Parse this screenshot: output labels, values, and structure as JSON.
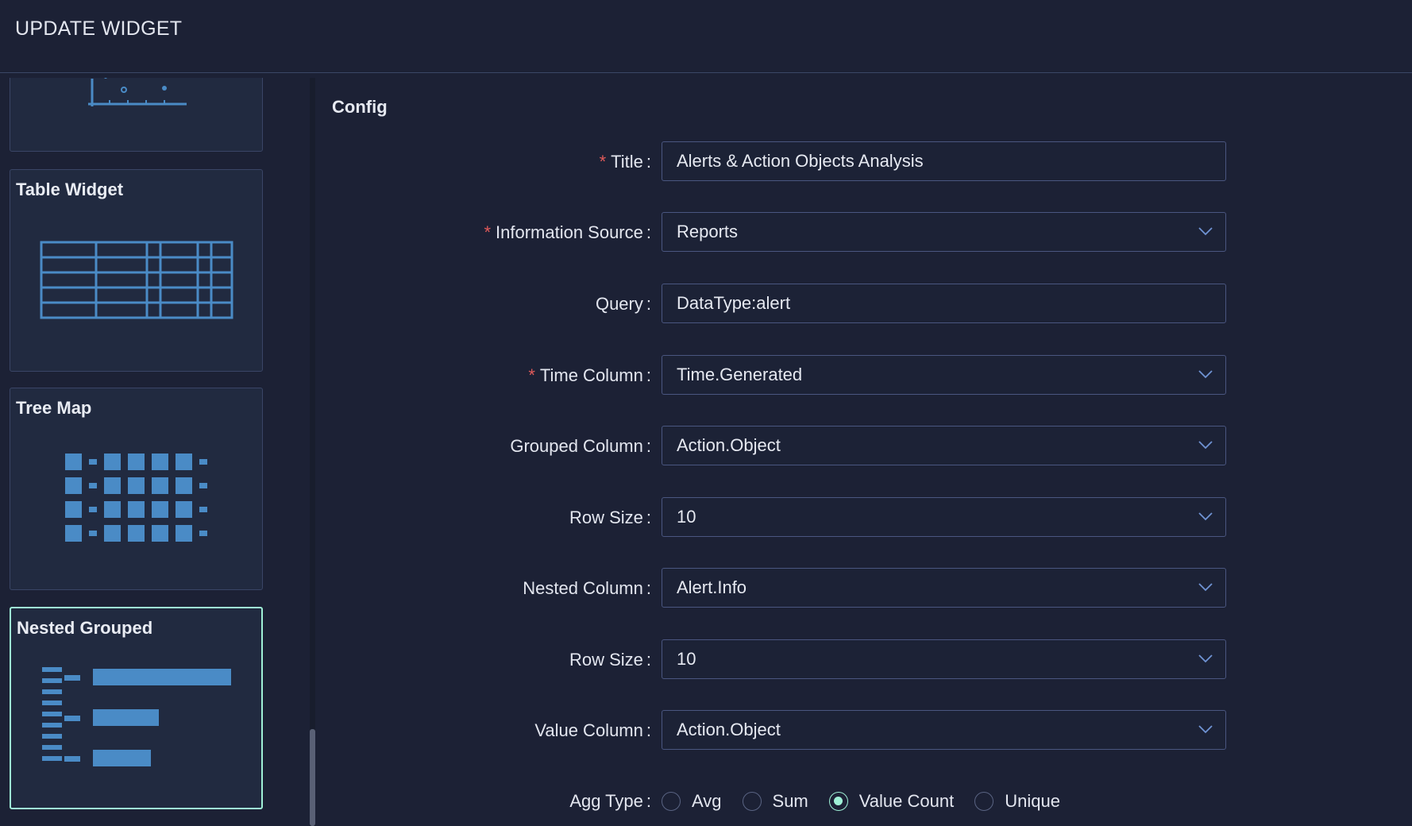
{
  "header": {
    "title": "UPDATE WIDGET"
  },
  "sidebar": {
    "cards": [
      {
        "title": "",
        "icon": "scatter-chart-icon"
      },
      {
        "title": "Table Widget",
        "icon": "table-grid-icon"
      },
      {
        "title": "Tree Map",
        "icon": "treemap-icon"
      },
      {
        "title": "Nested Grouped",
        "icon": "nested-bars-icon",
        "selected": true
      }
    ]
  },
  "config": {
    "title": "Config",
    "fields": {
      "title": {
        "label": "Title",
        "required": true,
        "value": "Alerts & Action Objects Analysis"
      },
      "info_source": {
        "label": "Information Source",
        "required": true,
        "value": "Reports"
      },
      "query": {
        "label": "Query",
        "required": false,
        "value": "DataType:alert"
      },
      "time_column": {
        "label": "Time Column",
        "required": true,
        "value": "Time.Generated"
      },
      "grouped_column": {
        "label": "Grouped Column",
        "required": false,
        "value": "Action.Object"
      },
      "row_size_1": {
        "label": "Row Size",
        "required": false,
        "value": "10"
      },
      "nested_column": {
        "label": "Nested Column",
        "required": false,
        "value": "Alert.Info"
      },
      "row_size_2": {
        "label": "Row Size",
        "required": false,
        "value": "10"
      },
      "value_column": {
        "label": "Value Column",
        "required": false,
        "value": "Action.Object"
      }
    },
    "agg_type": {
      "label": "Agg Type",
      "options": [
        "Avg",
        "Sum",
        "Value Count",
        "Unique"
      ],
      "selected": "Value Count"
    }
  },
  "colors": {
    "accent": "#9ff0d6",
    "icon_blue": "#4a8bc6",
    "required": "#e05a5a",
    "background": "#1c2135"
  }
}
